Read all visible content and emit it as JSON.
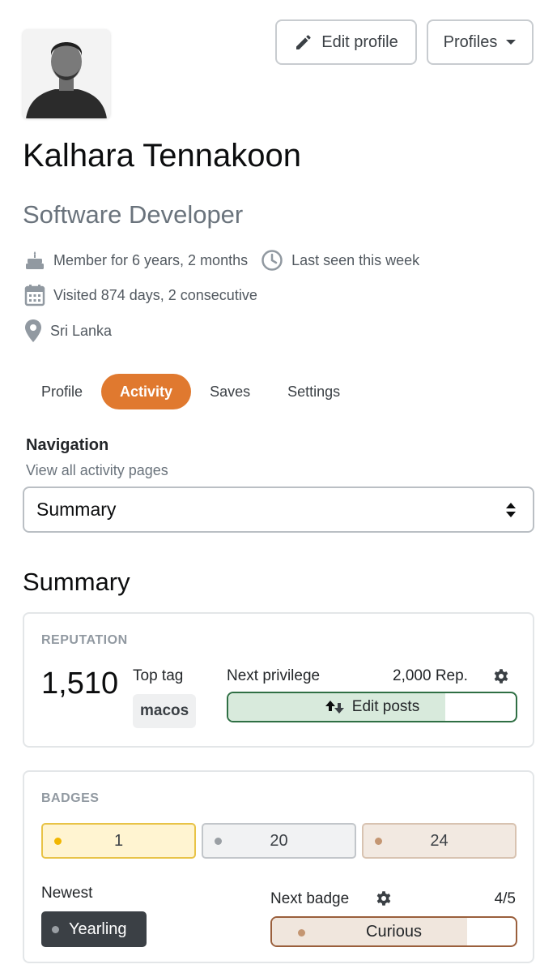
{
  "header": {
    "edit_profile_label": "Edit profile",
    "profiles_label": "Profiles"
  },
  "user": {
    "name": "Kalhara Tennakoon",
    "title": "Software Developer",
    "member_for": "Member for 6 years, 2 months",
    "last_seen": "Last seen this week",
    "visited": "Visited 874 days, 2 consecutive",
    "location": "Sri Lanka"
  },
  "tabs": [
    {
      "label": "Profile",
      "active": false
    },
    {
      "label": "Activity",
      "active": true
    },
    {
      "label": "Saves",
      "active": false
    },
    {
      "label": "Settings",
      "active": false
    }
  ],
  "navigation": {
    "title": "Navigation",
    "subtitle": "View all activity pages",
    "selected": "Summary"
  },
  "summary": {
    "title": "Summary",
    "reputation": {
      "label": "REPUTATION",
      "value": "1,510",
      "top_tag_label": "Top tag",
      "top_tag": "macos",
      "next_privilege_label": "Next privilege",
      "next_privilege_rep": "2,000 Rep.",
      "next_privilege_name": "Edit posts",
      "progress": 0.755
    },
    "badges": {
      "label": "BADGES",
      "gold": "1",
      "silver": "20",
      "bronze": "24",
      "newest_label": "Newest",
      "newest_badge": "Yearling",
      "next_badge_label": "Next badge",
      "next_badge_count": "4/5",
      "next_badge_name": "Curious",
      "next_badge_progress": 0.8
    }
  },
  "colors": {
    "accent": "#e0792f",
    "gold": "#f1b600",
    "silver": "#9a9fa4",
    "bronze": "#c49672",
    "privilege_border": "#2f6f44"
  },
  "icons": [
    "pencil-icon",
    "caret-down-icon",
    "cake-icon",
    "clock-icon",
    "calendar-icon",
    "location-pin-icon",
    "select-arrows-icon",
    "gear-icon",
    "arrows-up-down-icon"
  ]
}
